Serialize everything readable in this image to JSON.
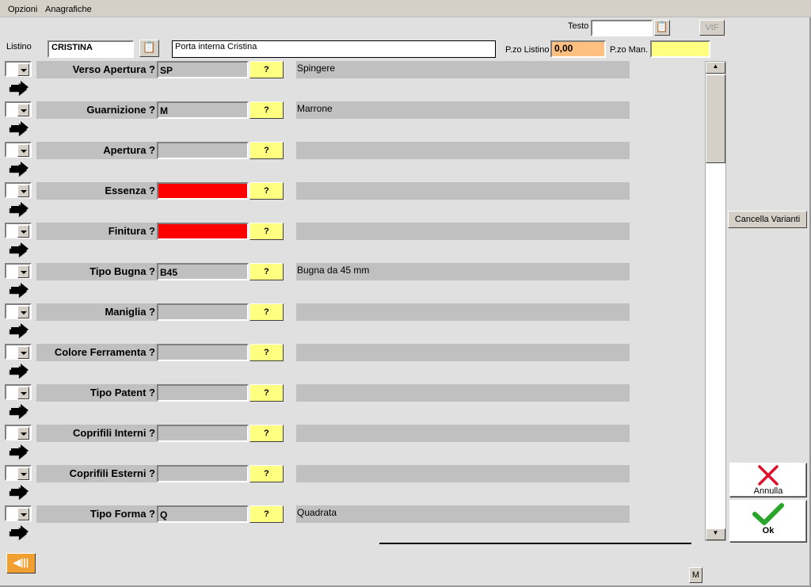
{
  "menu": [
    "Opzioni",
    "Anagrafiche"
  ],
  "header": {
    "testo_label": "Testo",
    "testo_value": "",
    "vif_label": "VtF",
    "listino_label": "Listino",
    "listino_value": "CRISTINA",
    "description_value": "Porta interna Cristina",
    "pzo_listino_label": "P.zo Listino",
    "pzo_listino_value": "0,00",
    "pzo_man_label": "P.zo Man.",
    "pzo_man_value": ""
  },
  "rows": [
    {
      "label": "Verso Apertura ?",
      "code": "SP",
      "desc": "Spingere",
      "missing": false
    },
    {
      "label": "Guarnizione ?",
      "code": "M",
      "desc": "Marrone",
      "missing": false
    },
    {
      "label": "Apertura ?",
      "code": "",
      "desc": "",
      "missing": false
    },
    {
      "label": "Essenza ?",
      "code": "",
      "desc": "",
      "missing": true
    },
    {
      "label": "Finitura ?",
      "code": "",
      "desc": "",
      "missing": true
    },
    {
      "label": "Tipo Bugna ?",
      "code": "B45",
      "desc": "Bugna da 45 mm",
      "missing": false
    },
    {
      "label": "Maniglia ?",
      "code": "",
      "desc": "",
      "missing": false
    },
    {
      "label": "Colore Ferramenta ?",
      "code": "",
      "desc": "",
      "missing": false
    },
    {
      "label": "Tipo Patent ?",
      "code": "",
      "desc": "",
      "missing": false
    },
    {
      "label": "Coprifili Interni ?",
      "code": "",
      "desc": "",
      "missing": false
    },
    {
      "label": "Coprifili Esterni ?",
      "code": "",
      "desc": "",
      "missing": false
    },
    {
      "label": "Tipo Forma ?",
      "code": "Q",
      "desc": "Quadrata",
      "missing": false
    }
  ],
  "qbtn_label": "?",
  "buttons": {
    "cancella_varianti": "Cancella Varianti",
    "annulla": "Annulla",
    "ok": "Ok",
    "m": "M"
  },
  "colors": {
    "missing": "#ff0000",
    "question": "#ffff80",
    "price": "#ffc080"
  }
}
